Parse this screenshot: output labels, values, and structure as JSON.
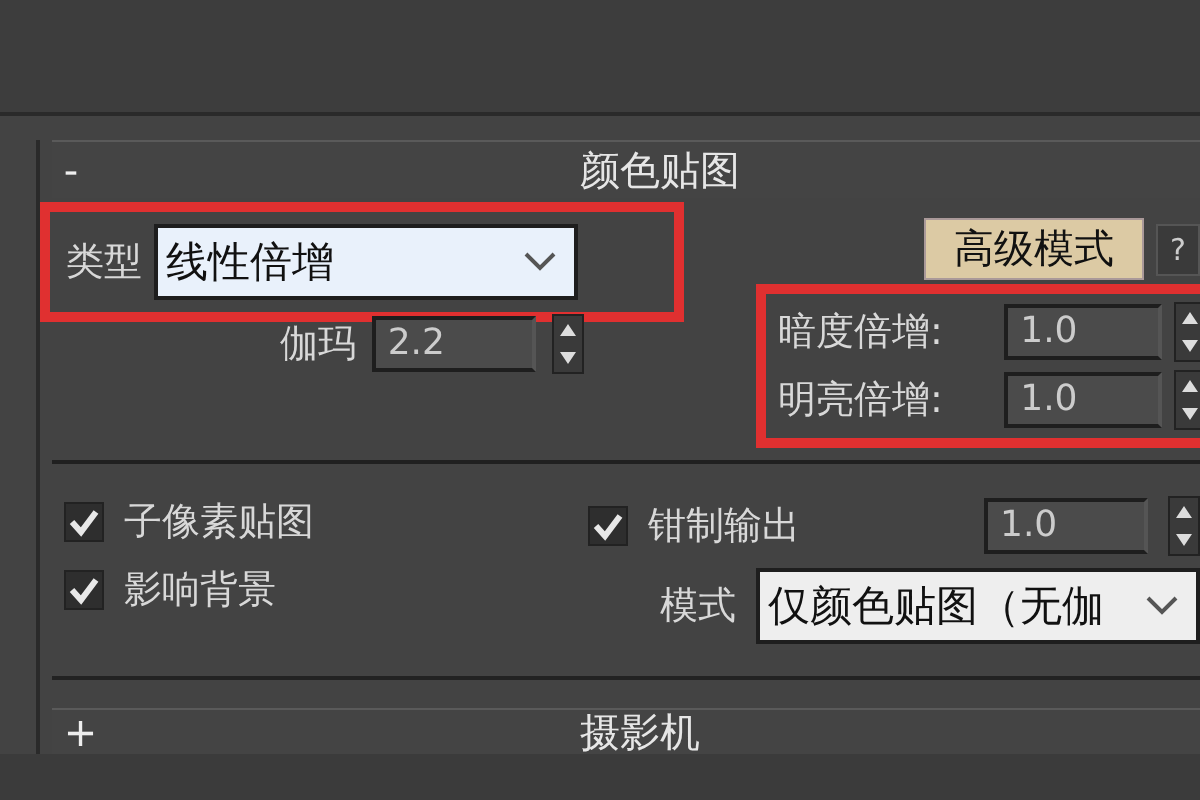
{
  "rollout": {
    "collapse_glyph": "-",
    "title": "颜色贴图",
    "type": {
      "label": "类型",
      "value": "线性倍增",
      "highlighted": true
    },
    "gamma": {
      "label": "伽玛",
      "value": "2.2"
    },
    "advanced_button": "高级模式",
    "help_button": "?",
    "multipliers": {
      "highlighted": true,
      "items": [
        {
          "label": "暗度倍增:",
          "value": "1.0"
        },
        {
          "label": "明亮倍增:",
          "value": "1.0"
        }
      ]
    },
    "options": [
      {
        "label": "子像素贴图",
        "checked": true
      },
      {
        "label": "影响背景",
        "checked": true
      }
    ],
    "clamp": {
      "label": "钳制输出",
      "checked": true,
      "value": "1.0"
    },
    "mode": {
      "label": "模式",
      "value": "仅颜色贴图（无伽"
    }
  },
  "next_rollout": {
    "expand_glyph": "+",
    "title": "摄影机"
  }
}
